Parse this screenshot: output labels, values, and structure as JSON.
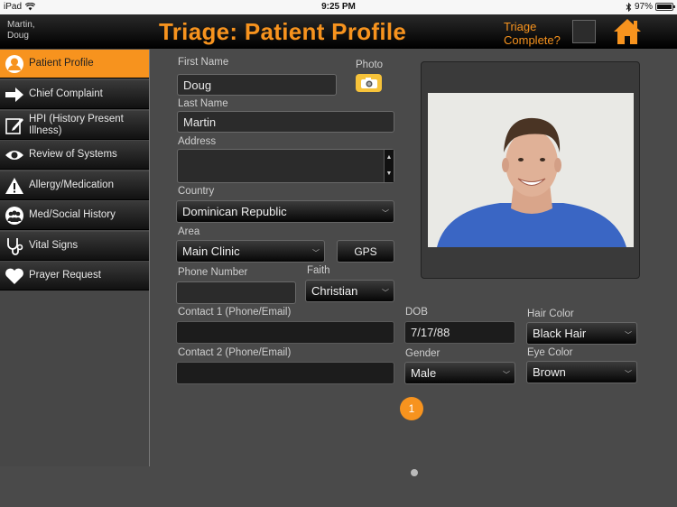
{
  "status_bar": {
    "device": "iPad",
    "time": "9:25 PM",
    "battery": "97%"
  },
  "header": {
    "user_name": "Martin,\nDoug",
    "title": "Triage: Patient Profile",
    "triage_label": "Triage\nComplete?"
  },
  "sidebar": {
    "items": [
      {
        "label": "Patient Profile",
        "icon": "person-icon"
      },
      {
        "label": "Chief Complaint",
        "icon": "arrow-right-icon"
      },
      {
        "label": "HPI (History Present Illness)",
        "icon": "edit-icon"
      },
      {
        "label": "Review of Systems",
        "icon": "eye-icon"
      },
      {
        "label": "Allergy/Medication",
        "icon": "warning-icon"
      },
      {
        "label": "Med/Social History",
        "icon": "group-icon"
      },
      {
        "label": "Vital Signs",
        "icon": "stethoscope-icon"
      },
      {
        "label": "Prayer Request",
        "icon": "heart-icon"
      }
    ]
  },
  "form": {
    "first_name_label": "First Name",
    "first_name": "Doug",
    "photo_label": "Photo",
    "last_name_label": "Last Name",
    "last_name": "Martin",
    "address_label": "Address",
    "address": "",
    "country_label": "Country",
    "country": "Dominican Republic",
    "area_label": "Area",
    "area": "Main Clinic",
    "gps_label": "GPS",
    "phone_label": "Phone Number",
    "phone": "",
    "faith_label": "Faith",
    "faith": "Christian",
    "contact1_label": "Contact 1 (Phone/Email)",
    "contact1": "",
    "contact2_label": "Contact 2 (Phone/Email)",
    "contact2": "",
    "dob_label": "DOB",
    "dob": "7/17/88",
    "hair_color_label": "Hair Color",
    "hair_color": "Black Hair",
    "gender_label": "Gender",
    "gender": "Male",
    "eye_color_label": "Eye Color",
    "eye_color": "Brown"
  },
  "pager": {
    "current": "1"
  },
  "colors": {
    "accent": "#f7931e",
    "photo_button": "#f7c33a"
  }
}
